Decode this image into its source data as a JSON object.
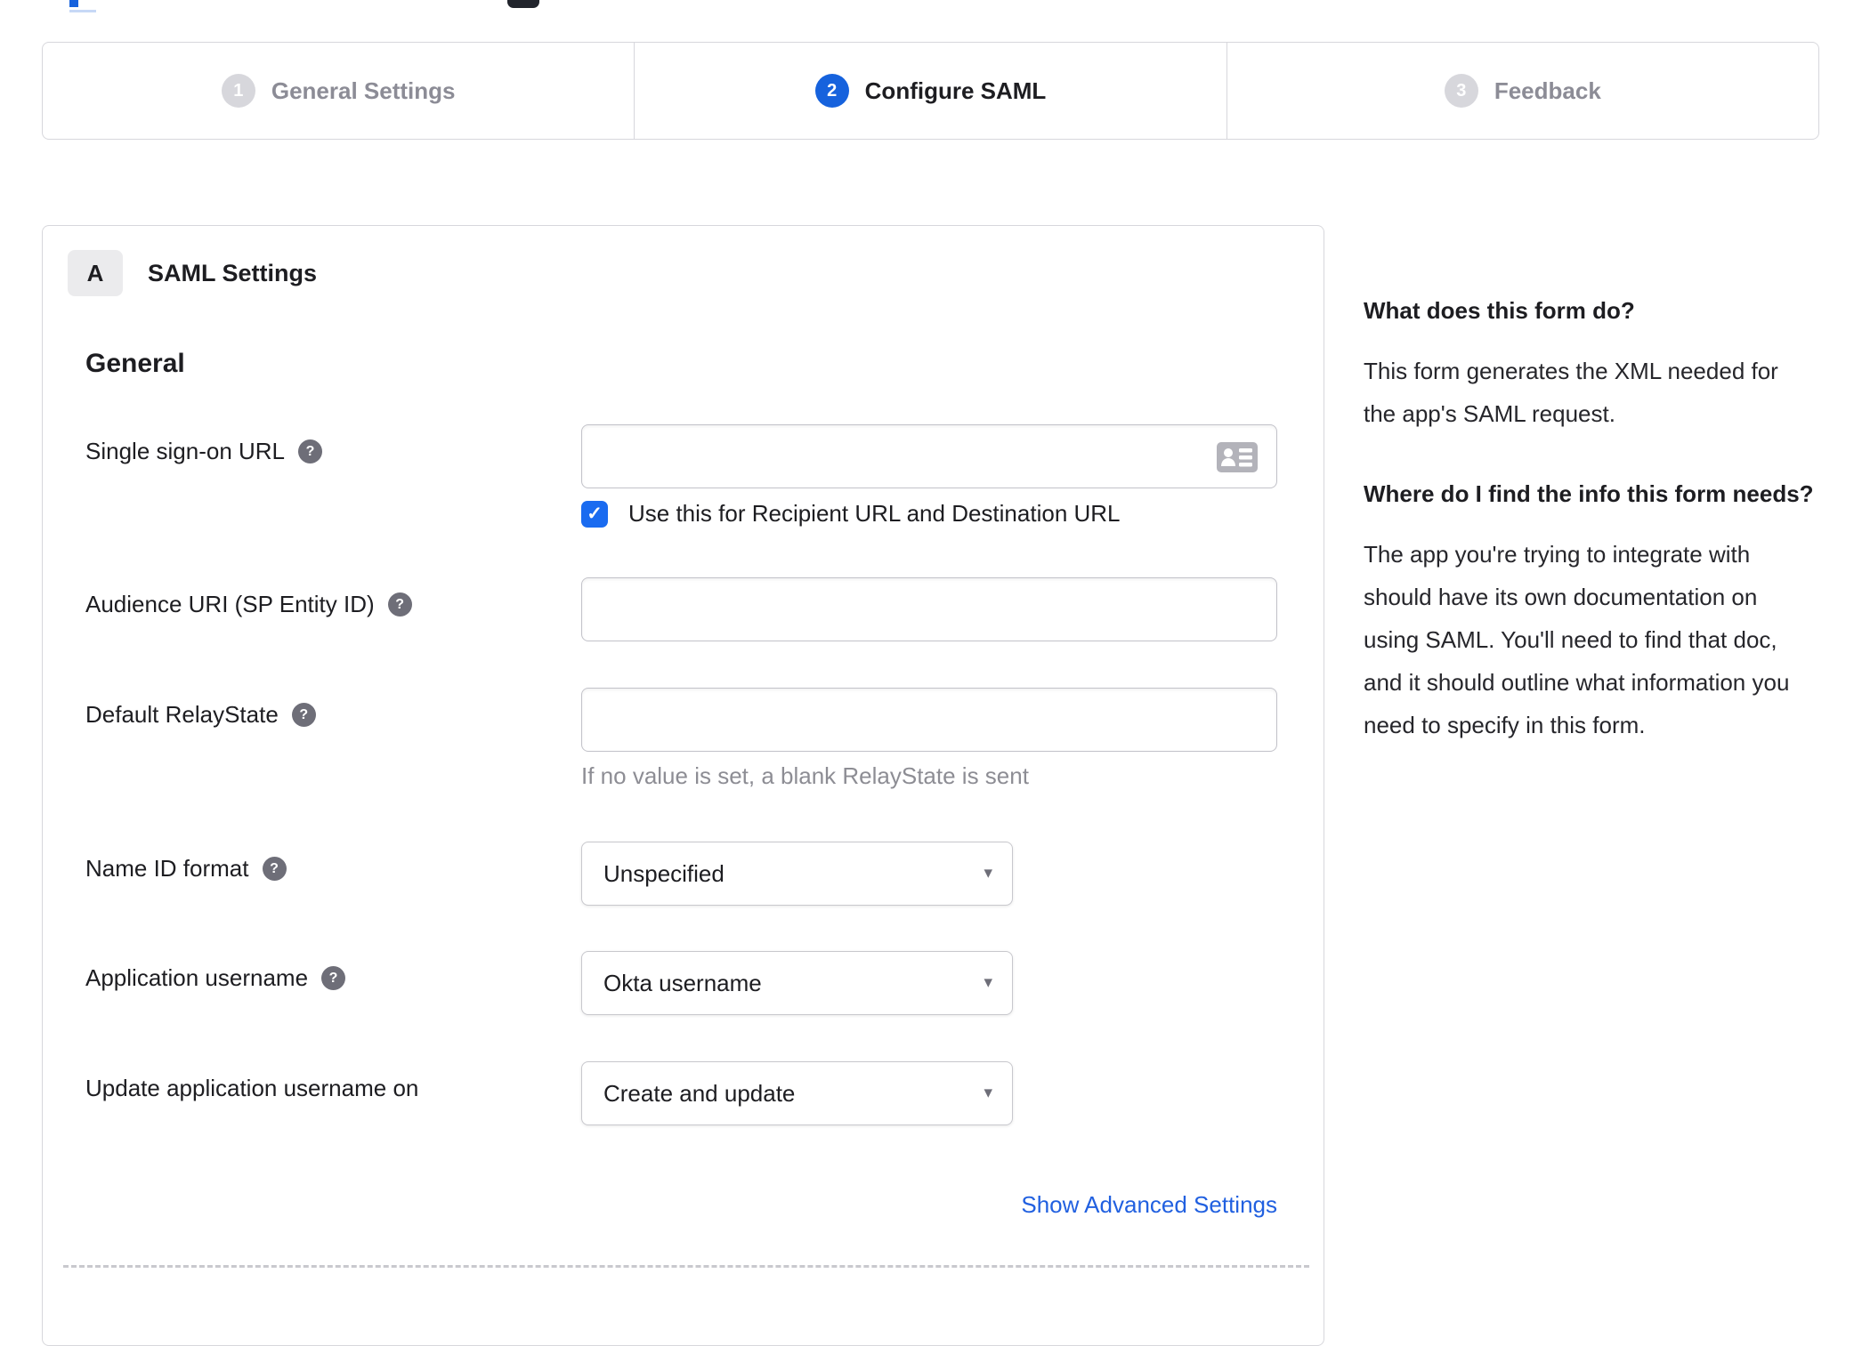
{
  "colors": {
    "accent": "#1662dd",
    "check-blue": "#1a6bf0",
    "link": "#2160e0",
    "border": "#d7d7dc",
    "circle-gray": "#d7d7dc",
    "inactive-gray": "#8c8c96",
    "helper": "#8d8d94"
  },
  "icons": {
    "help_glyph": "?",
    "check_glyph": "✓",
    "caret_glyph": "▾"
  },
  "stepper": {
    "steps": [
      {
        "number": "1",
        "label": "General Settings",
        "state": "inactive"
      },
      {
        "number": "2",
        "label": "Configure SAML",
        "state": "active"
      },
      {
        "number": "3",
        "label": "Feedback",
        "state": "inactive"
      }
    ]
  },
  "panel": {
    "badge": "A",
    "title": "SAML Settings",
    "section_heading": "General",
    "fields": [
      {
        "label": "Single sign-on URL",
        "type": "text",
        "value": "",
        "checkbox": {
          "checked": true,
          "label": "Use this for Recipient URL and Destination URL"
        }
      },
      {
        "label": "Audience URI (SP Entity ID)",
        "type": "text",
        "value": ""
      },
      {
        "label": "Default RelayState",
        "type": "text",
        "value": "",
        "helper": "If no value is set, a blank RelayState is sent"
      },
      {
        "label": "Name ID format",
        "type": "select",
        "value": "Unspecified"
      },
      {
        "label": "Application username",
        "type": "select",
        "value": "Okta username"
      },
      {
        "label": "Update application username on",
        "type": "select",
        "value": "Create and update"
      }
    ],
    "advanced_link": "Show Advanced Settings"
  },
  "sidebar": {
    "q1": "What does this form do?",
    "a1": "This form generates the XML needed for the app's SAML request.",
    "q2": "Where do I find the info this form needs?",
    "a2": "The app you're trying to integrate with should have its own documentation on using SAML. You'll need to find that doc, and it should outline what information you need to specify in this form."
  }
}
